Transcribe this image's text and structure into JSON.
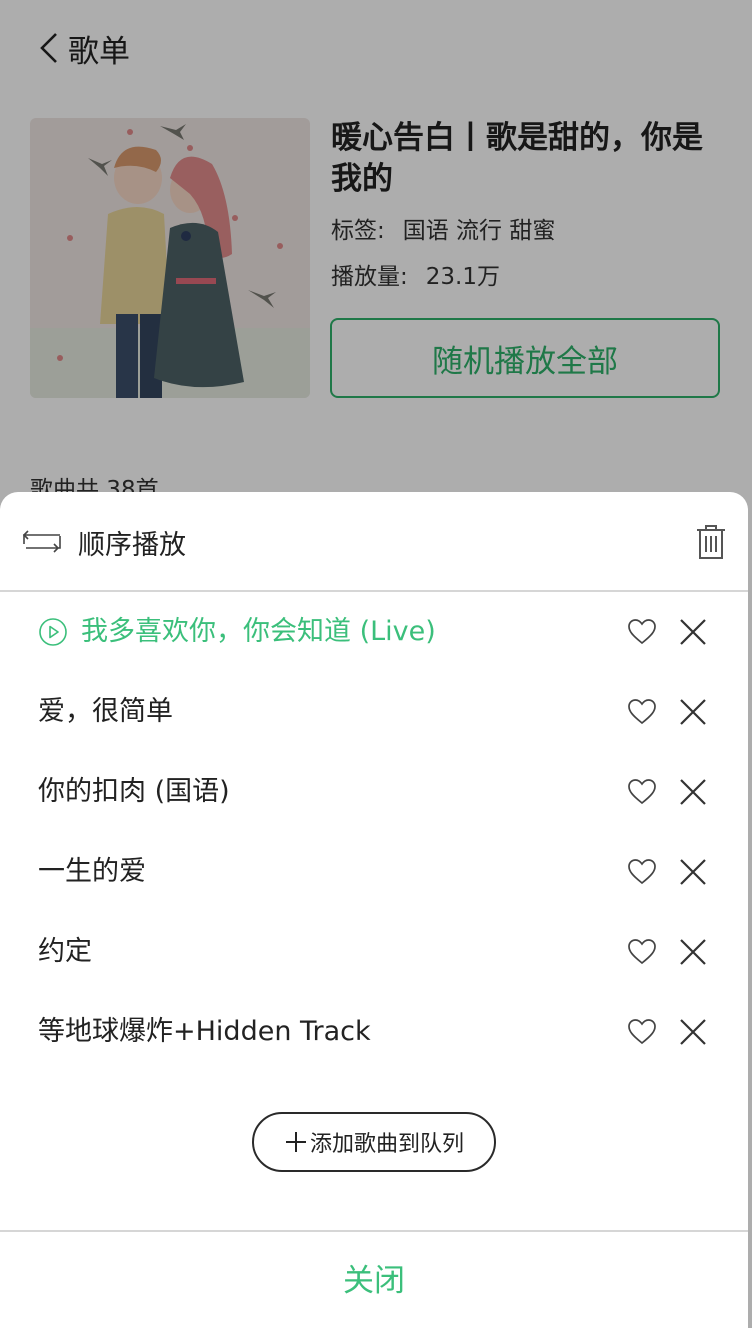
{
  "nav": {
    "title": "歌单"
  },
  "playlist": {
    "name": "暖心告白丨歌是甜的，你是我的",
    "tags_label": "标签:",
    "tags": "国语 流行 甜蜜",
    "plays_label": "播放量:",
    "plays": "23.1万",
    "shuffle_label": "随机播放全部",
    "count_text": "歌曲共 38首"
  },
  "queue": {
    "mode_label": "顺序播放",
    "songs": [
      {
        "title": "我多喜欢你，你会知道 (Live)",
        "playing": true
      },
      {
        "title": "爱，很简单",
        "playing": false
      },
      {
        "title": "你的扣肉 (国语)",
        "playing": false
      },
      {
        "title": "一生的爱",
        "playing": false
      },
      {
        "title": "约定",
        "playing": false
      },
      {
        "title": "等地球爆炸+Hidden Track",
        "playing": false
      }
    ],
    "add_label": "添加歌曲到队列",
    "close_label": "关闭"
  },
  "colors": {
    "accent": "#3bbf7b",
    "accent_border": "#2fb26a",
    "mask": "rgba(0,0,0,0.32)"
  },
  "icons": [
    "back-arrow-icon",
    "cover-art-image",
    "sequential-loop-icon",
    "trash-icon",
    "play-circle-icon",
    "heart-icon",
    "close-x-icon",
    "plus-icon"
  ]
}
